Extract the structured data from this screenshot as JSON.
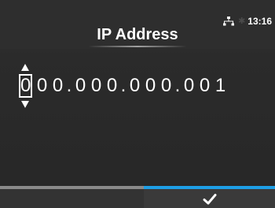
{
  "header": {
    "title": "IP Address",
    "status": {
      "time": "13:16",
      "network_icon": "network-icon",
      "bluetooth_icon": "bluetooth-icon",
      "bluetooth_glyph": "✱"
    }
  },
  "ip_editor": {
    "digits": [
      "0",
      "0",
      "0",
      ".",
      "0",
      "0",
      "0",
      ".",
      "0",
      "0",
      "0",
      ".",
      "0",
      "0",
      "1"
    ],
    "selected_index": 0
  },
  "footer": {
    "left_softkey": "",
    "right_softkey_icon": "check-icon"
  },
  "colors": {
    "accent": "#1e9fe6",
    "background": "#2b2b2b",
    "text": "#ffffff"
  }
}
